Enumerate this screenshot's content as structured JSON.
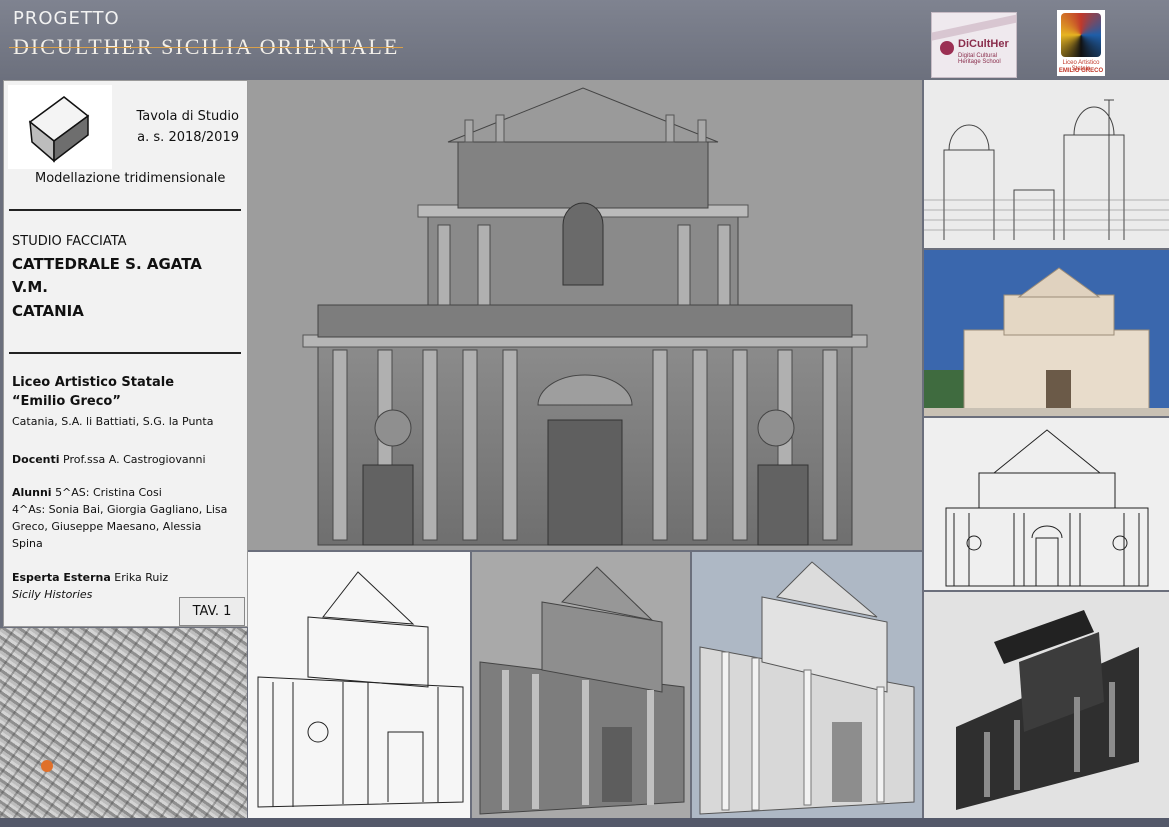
{
  "header": {
    "project_label": "PROGETTO",
    "project_title": "DICULTHER SICILIA ORIENTALE",
    "logo_diculther": {
      "name": "DiCultHer",
      "tagline": "Digital Cultural Heritage School"
    },
    "logo_liceo": {
      "line1": "Liceo Artistico Statale",
      "line2": "EMILIO GRECO"
    }
  },
  "info_panel": {
    "tavola": "Tavola di Studio",
    "anno": "a. s. 2018/2019",
    "modellazione": "Modellazione tridimensionale",
    "studio": "STUDIO FACCIATA",
    "titolo_line1": "CATTEDRALE S. AGATA",
    "titolo_line2": "V.M.",
    "titolo_line3": "CATANIA",
    "scuola_line1": "Liceo Artistico Statale",
    "scuola_line2": "“Emilio Greco”",
    "sedi": "Catania, S.A. li Battiati, S.G. la Punta",
    "docenti_label": "Docenti",
    "docenti_value": "Prof.ssa A. Castrogiovanni",
    "alunni_label": "Alunni",
    "alunni_line1": "5^AS: Cristina Cosi",
    "alunni_line2": "4^As: Sonia Bai, Giorgia Gagliano, Lisa",
    "alunni_line3": "Greco, Giuseppe Maesano, Alessia",
    "alunni_line4": "Spina",
    "esperta_label": "Esperta Esterna",
    "esperta_value": "Erika Ruiz",
    "esperta_org": "Sicily Histories",
    "tav": "TAV. 1"
  },
  "colors": {
    "header_bg": "#7a7e8b",
    "accent_line": "#d9a04a",
    "panel_bg": "#f2f2f2",
    "render_bg": "#9a9a9a",
    "map_marker": "#e0702a"
  },
  "icons": {
    "cube": "cube-icon",
    "map_marker": "location-marker-icon"
  }
}
